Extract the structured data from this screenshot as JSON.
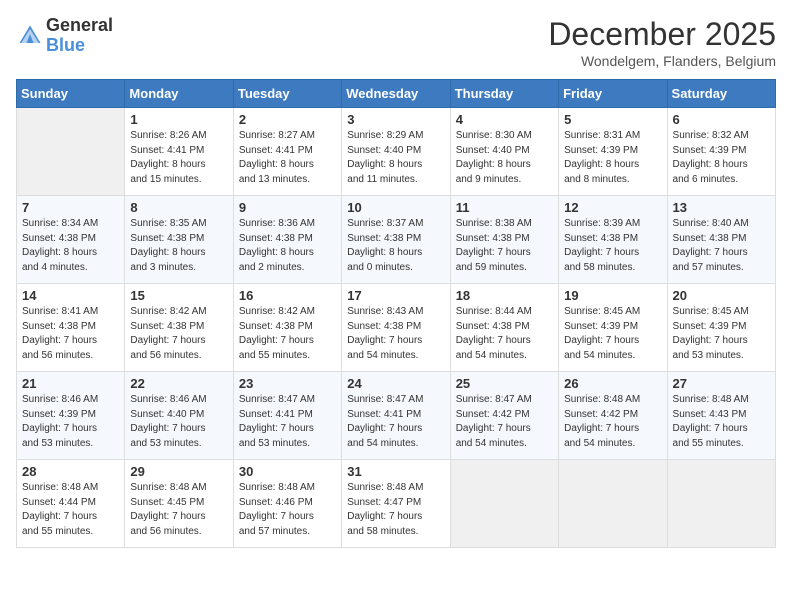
{
  "logo": {
    "general": "General",
    "blue": "Blue"
  },
  "title": "December 2025",
  "location": "Wondelgem, Flanders, Belgium",
  "headers": [
    "Sunday",
    "Monday",
    "Tuesday",
    "Wednesday",
    "Thursday",
    "Friday",
    "Saturday"
  ],
  "weeks": [
    [
      {
        "day": "",
        "info": ""
      },
      {
        "day": "1",
        "info": "Sunrise: 8:26 AM\nSunset: 4:41 PM\nDaylight: 8 hours\nand 15 minutes."
      },
      {
        "day": "2",
        "info": "Sunrise: 8:27 AM\nSunset: 4:41 PM\nDaylight: 8 hours\nand 13 minutes."
      },
      {
        "day": "3",
        "info": "Sunrise: 8:29 AM\nSunset: 4:40 PM\nDaylight: 8 hours\nand 11 minutes."
      },
      {
        "day": "4",
        "info": "Sunrise: 8:30 AM\nSunset: 4:40 PM\nDaylight: 8 hours\nand 9 minutes."
      },
      {
        "day": "5",
        "info": "Sunrise: 8:31 AM\nSunset: 4:39 PM\nDaylight: 8 hours\nand 8 minutes."
      },
      {
        "day": "6",
        "info": "Sunrise: 8:32 AM\nSunset: 4:39 PM\nDaylight: 8 hours\nand 6 minutes."
      }
    ],
    [
      {
        "day": "7",
        "info": "Sunrise: 8:34 AM\nSunset: 4:38 PM\nDaylight: 8 hours\nand 4 minutes."
      },
      {
        "day": "8",
        "info": "Sunrise: 8:35 AM\nSunset: 4:38 PM\nDaylight: 8 hours\nand 3 minutes."
      },
      {
        "day": "9",
        "info": "Sunrise: 8:36 AM\nSunset: 4:38 PM\nDaylight: 8 hours\nand 2 minutes."
      },
      {
        "day": "10",
        "info": "Sunrise: 8:37 AM\nSunset: 4:38 PM\nDaylight: 8 hours\nand 0 minutes."
      },
      {
        "day": "11",
        "info": "Sunrise: 8:38 AM\nSunset: 4:38 PM\nDaylight: 7 hours\nand 59 minutes."
      },
      {
        "day": "12",
        "info": "Sunrise: 8:39 AM\nSunset: 4:38 PM\nDaylight: 7 hours\nand 58 minutes."
      },
      {
        "day": "13",
        "info": "Sunrise: 8:40 AM\nSunset: 4:38 PM\nDaylight: 7 hours\nand 57 minutes."
      }
    ],
    [
      {
        "day": "14",
        "info": "Sunrise: 8:41 AM\nSunset: 4:38 PM\nDaylight: 7 hours\nand 56 minutes."
      },
      {
        "day": "15",
        "info": "Sunrise: 8:42 AM\nSunset: 4:38 PM\nDaylight: 7 hours\nand 56 minutes."
      },
      {
        "day": "16",
        "info": "Sunrise: 8:42 AM\nSunset: 4:38 PM\nDaylight: 7 hours\nand 55 minutes."
      },
      {
        "day": "17",
        "info": "Sunrise: 8:43 AM\nSunset: 4:38 PM\nDaylight: 7 hours\nand 54 minutes."
      },
      {
        "day": "18",
        "info": "Sunrise: 8:44 AM\nSunset: 4:38 PM\nDaylight: 7 hours\nand 54 minutes."
      },
      {
        "day": "19",
        "info": "Sunrise: 8:45 AM\nSunset: 4:39 PM\nDaylight: 7 hours\nand 54 minutes."
      },
      {
        "day": "20",
        "info": "Sunrise: 8:45 AM\nSunset: 4:39 PM\nDaylight: 7 hours\nand 53 minutes."
      }
    ],
    [
      {
        "day": "21",
        "info": "Sunrise: 8:46 AM\nSunset: 4:39 PM\nDaylight: 7 hours\nand 53 minutes."
      },
      {
        "day": "22",
        "info": "Sunrise: 8:46 AM\nSunset: 4:40 PM\nDaylight: 7 hours\nand 53 minutes."
      },
      {
        "day": "23",
        "info": "Sunrise: 8:47 AM\nSunset: 4:41 PM\nDaylight: 7 hours\nand 53 minutes."
      },
      {
        "day": "24",
        "info": "Sunrise: 8:47 AM\nSunset: 4:41 PM\nDaylight: 7 hours\nand 54 minutes."
      },
      {
        "day": "25",
        "info": "Sunrise: 8:47 AM\nSunset: 4:42 PM\nDaylight: 7 hours\nand 54 minutes."
      },
      {
        "day": "26",
        "info": "Sunrise: 8:48 AM\nSunset: 4:42 PM\nDaylight: 7 hours\nand 54 minutes."
      },
      {
        "day": "27",
        "info": "Sunrise: 8:48 AM\nSunset: 4:43 PM\nDaylight: 7 hours\nand 55 minutes."
      }
    ],
    [
      {
        "day": "28",
        "info": "Sunrise: 8:48 AM\nSunset: 4:44 PM\nDaylight: 7 hours\nand 55 minutes."
      },
      {
        "day": "29",
        "info": "Sunrise: 8:48 AM\nSunset: 4:45 PM\nDaylight: 7 hours\nand 56 minutes."
      },
      {
        "day": "30",
        "info": "Sunrise: 8:48 AM\nSunset: 4:46 PM\nDaylight: 7 hours\nand 57 minutes."
      },
      {
        "day": "31",
        "info": "Sunrise: 8:48 AM\nSunset: 4:47 PM\nDaylight: 7 hours\nand 58 minutes."
      },
      {
        "day": "",
        "info": ""
      },
      {
        "day": "",
        "info": ""
      },
      {
        "day": "",
        "info": ""
      }
    ]
  ]
}
